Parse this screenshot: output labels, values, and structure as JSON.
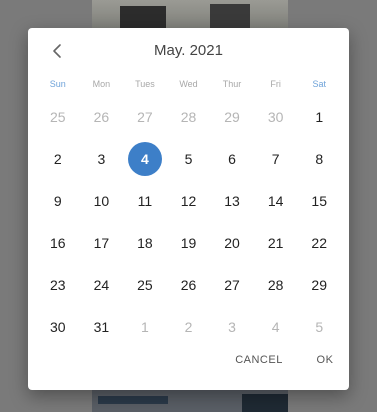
{
  "calendar": {
    "title": "May. 2021",
    "weekdays": [
      "Sun",
      "Mon",
      "Tues",
      "Wed",
      "Thur",
      "Fri",
      "Sat"
    ],
    "selected_day": "4",
    "accent_color": "#3d7fc8",
    "weekend_color": "#6fa3d9",
    "weeks": [
      [
        {
          "d": "25",
          "m": true
        },
        {
          "d": "26",
          "m": true
        },
        {
          "d": "27",
          "m": true
        },
        {
          "d": "28",
          "m": true
        },
        {
          "d": "29",
          "m": true
        },
        {
          "d": "30",
          "m": true
        },
        {
          "d": "1",
          "m": false
        }
      ],
      [
        {
          "d": "2",
          "m": false
        },
        {
          "d": "3",
          "m": false
        },
        {
          "d": "4",
          "m": false
        },
        {
          "d": "5",
          "m": false
        },
        {
          "d": "6",
          "m": false
        },
        {
          "d": "7",
          "m": false
        },
        {
          "d": "8",
          "m": false
        }
      ],
      [
        {
          "d": "9",
          "m": false
        },
        {
          "d": "10",
          "m": false
        },
        {
          "d": "11",
          "m": false
        },
        {
          "d": "12",
          "m": false
        },
        {
          "d": "13",
          "m": false
        },
        {
          "d": "14",
          "m": false
        },
        {
          "d": "15",
          "m": false
        }
      ],
      [
        {
          "d": "16",
          "m": false
        },
        {
          "d": "17",
          "m": false
        },
        {
          "d": "18",
          "m": false
        },
        {
          "d": "19",
          "m": false
        },
        {
          "d": "20",
          "m": false
        },
        {
          "d": "21",
          "m": false
        },
        {
          "d": "22",
          "m": false
        }
      ],
      [
        {
          "d": "23",
          "m": false
        },
        {
          "d": "24",
          "m": false
        },
        {
          "d": "25",
          "m": false
        },
        {
          "d": "26",
          "m": false
        },
        {
          "d": "27",
          "m": false
        },
        {
          "d": "28",
          "m": false
        },
        {
          "d": "29",
          "m": false
        }
      ],
      [
        {
          "d": "30",
          "m": false
        },
        {
          "d": "31",
          "m": false
        },
        {
          "d": "1",
          "m": true
        },
        {
          "d": "2",
          "m": true
        },
        {
          "d": "3",
          "m": true
        },
        {
          "d": "4",
          "m": true
        },
        {
          "d": "5",
          "m": true
        }
      ]
    ]
  },
  "icons": {
    "prev": "chevron-left-icon"
  },
  "actions": {
    "cancel_label": "CANCEL",
    "ok_label": "OK"
  }
}
